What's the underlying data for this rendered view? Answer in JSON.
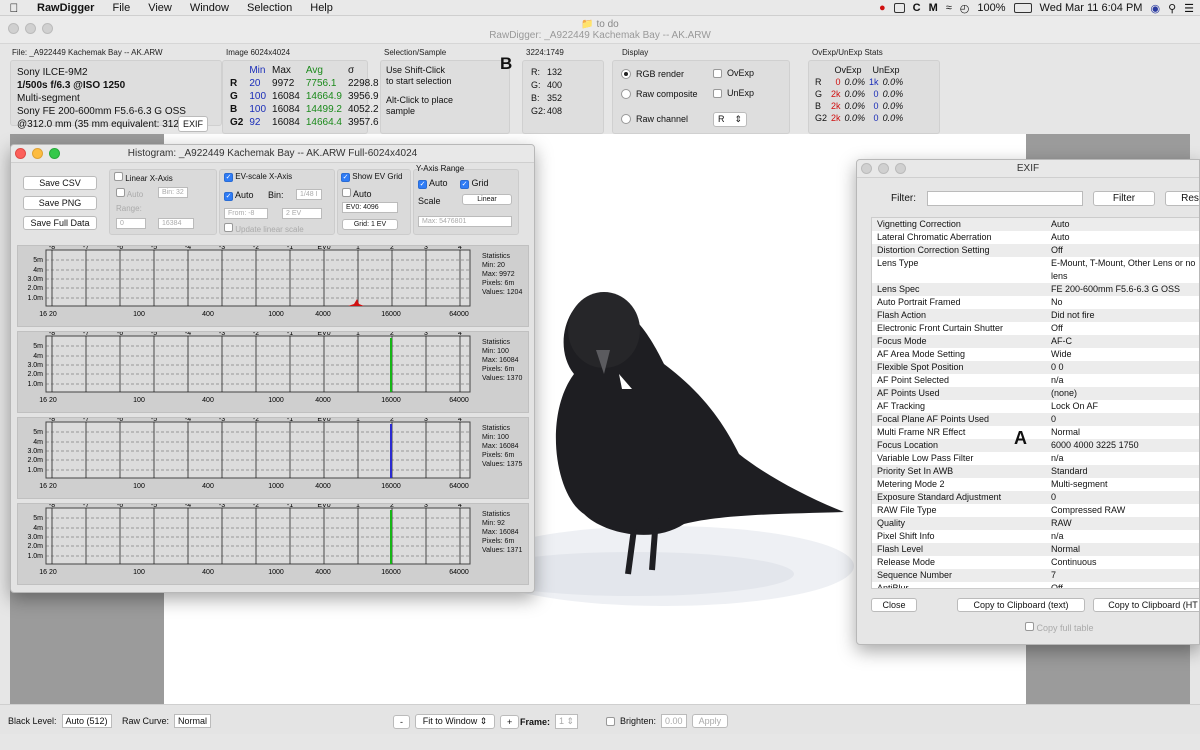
{
  "menubar": {
    "app": "RawDigger",
    "items": [
      "File",
      "View",
      "Window",
      "Selection",
      "Help"
    ],
    "battery": "100%",
    "clock": "Wed Mar 11  6:04 PM"
  },
  "window": {
    "folder": "to do",
    "title": "RawDigger: _A922449 Kachemak Bay -- AK.ARW"
  },
  "file_info": {
    "label": "File: _A922449 Kachemak Bay -- AK.ARW",
    "camera": "Sony ILCE-9M2",
    "exposure": "1/500s f/6.3 @ISO 1250",
    "metering": "Multi-segment",
    "lens": "Sony FE 200-600mm F5.6-6.3 G OSS",
    "focal": "@312.0 mm (35 mm equivalent: 312.0",
    "exif_button": "EXIF"
  },
  "image_stats": {
    "label": "Image 6024x4024",
    "headers": [
      "",
      "Min",
      "Max",
      "Avg",
      "σ"
    ],
    "rows": [
      {
        "ch": "R",
        "min": "20",
        "max": "9972",
        "avg": "7756.1",
        "sd": "2298.8"
      },
      {
        "ch": "G",
        "min": "100",
        "max": "16084",
        "avg": "14664.9",
        "sd": "3956.9"
      },
      {
        "ch": "B",
        "min": "100",
        "max": "16084",
        "avg": "14499.2",
        "sd": "4052.2"
      },
      {
        "ch": "G2",
        "min": "92",
        "max": "16084",
        "avg": "14664.4",
        "sd": "3957.6"
      }
    ]
  },
  "selection": {
    "label": "Selection/Sample",
    "line1": "Use Shift-Click",
    "line2": "to start selection",
    "line3": "Alt-Click to place",
    "line4": "sample"
  },
  "marker_b": "B",
  "marker_a": "A",
  "sample": {
    "label": "3224:1749",
    "r": "R:",
    "r_val": "132",
    "g": "G:",
    "g_val": "400",
    "b": "B:",
    "b_val": "352",
    "g2": "G2:",
    "g2_val": "408"
  },
  "display": {
    "label": "Display",
    "rgb_render": "RGB render",
    "raw_composite": "Raw composite",
    "raw_channel": "Raw channel",
    "ovexp": "OvExp",
    "unexp": "UnExp",
    "channel_value": "R"
  },
  "ovexp_stats": {
    "label": "OvExp/UnExp Stats",
    "h1": "OvExp",
    "h2": "UnExp",
    "rows": [
      {
        "ch": "R",
        "o": "0",
        "op": "0.0%",
        "u": "1k",
        "up": "0.0%"
      },
      {
        "ch": "G",
        "o": "2k",
        "op": "0.0%",
        "u": "0",
        "up": "0.0%"
      },
      {
        "ch": "B",
        "o": "2k",
        "op": "0.0%",
        "u": "0",
        "up": "0.0%"
      },
      {
        "ch": "G2",
        "o": "2k",
        "op": "0.0%",
        "u": "0",
        "up": "0.0%"
      }
    ]
  },
  "histogram": {
    "title": "Histogram: _A922449 Kachemak Bay -- AK.ARW Full-6024x4024",
    "save_csv": "Save CSV",
    "save_png": "Save PNG",
    "save_full": "Save Full Data",
    "linear_x": "Linear X-Axis",
    "auto": "Auto",
    "bin32": "Bin: 32",
    "range": "Range:",
    "range_from": "0",
    "range_to": "16384",
    "ev_scale": "EV-scale X-Axis",
    "auto2": "Auto",
    "bin": "Bin:",
    "bin_val": "1/48 I",
    "from": "From: -8",
    "to_val": "2 EV",
    "update_linear": "Update linear scale",
    "show_ev_grid": "Show EV Grid",
    "auto3": "Auto",
    "ev0": "EV0: 4096",
    "grid_ev": "Grid: 1 EV",
    "y_range": "Y-Axis Range",
    "auto4": "Auto",
    "grid": "Grid",
    "scale": "Scale",
    "scale_val": "Linear",
    "max_val": "Max: 5476801",
    "ev_ticks": [
      "-8",
      "-7",
      "-6",
      "-5",
      "-4",
      "-3",
      "-2",
      "-1",
      "EV0",
      "1",
      "2",
      "3",
      "4"
    ],
    "x_ticks": [
      "16 20",
      "100",
      "400",
      "1000",
      "4000",
      "16000",
      "64000"
    ],
    "y_ticks": [
      "5m",
      "4m",
      "3.0m",
      "2.0m",
      "1.0m"
    ],
    "graphs": [
      {
        "color": "#d01010",
        "stats_title": "Statistics",
        "min": "Min: 20",
        "max": "Max: 9972",
        "pixels": "Pixels: 6m",
        "values": "Values: 1204"
      },
      {
        "color": "#15b515",
        "stats_title": "Statistics",
        "min": "Min: 100",
        "max": "Max: 16084",
        "pixels": "Pixels: 6m",
        "values": "Values: 1370"
      },
      {
        "color": "#2a2ad0",
        "stats_title": "Statistics",
        "min": "Min: 100",
        "max": "Max: 16084",
        "pixels": "Pixels: 6m",
        "values": "Values: 1375"
      },
      {
        "color": "#15b515",
        "stats_title": "Statistics",
        "min": "Min: 92",
        "max": "Max: 16084",
        "pixels": "Pixels: 6m",
        "values": "Values: 1371"
      }
    ]
  },
  "exif": {
    "title": "EXIF",
    "filter_label": "Filter:",
    "filter_value": "",
    "filter_button": "Filter",
    "reset_button": "Res",
    "rows": [
      {
        "k": "Vignetting Correction",
        "v": "Auto"
      },
      {
        "k": "Lateral Chromatic Aberration",
        "v": "Auto"
      },
      {
        "k": "Distortion Correction Setting",
        "v": "Off"
      },
      {
        "k": "Lens Type",
        "v": "E-Mount, T-Mount, Other Lens or no lens"
      },
      {
        "k": "Lens Spec",
        "v": "FE 200-600mm F5.6-6.3 G OSS"
      },
      {
        "k": "Auto Portrait Framed",
        "v": "No"
      },
      {
        "k": "Flash Action",
        "v": "Did not fire"
      },
      {
        "k": "Electronic Front Curtain Shutter",
        "v": "Off"
      },
      {
        "k": "Focus Mode",
        "v": "AF-C"
      },
      {
        "k": "AF Area Mode Setting",
        "v": "Wide"
      },
      {
        "k": "Flexible Spot Position",
        "v": "0 0"
      },
      {
        "k": "AF Point Selected",
        "v": "n/a"
      },
      {
        "k": "AF Points Used",
        "v": "(none)"
      },
      {
        "k": "AF Tracking",
        "v": "Lock On AF"
      },
      {
        "k": "Focal Plane AF Points Used",
        "v": "0"
      },
      {
        "k": "Multi Frame NR Effect",
        "v": "Normal"
      },
      {
        "k": "Focus Location",
        "v": "6000 4000 3225 1750"
      },
      {
        "k": "Variable Low Pass Filter",
        "v": "n/a"
      },
      {
        "k": "Priority Set In AWB",
        "v": "Standard"
      },
      {
        "k": "Metering Mode 2",
        "v": "Multi-segment"
      },
      {
        "k": "Exposure Standard Adjustment",
        "v": "0"
      },
      {
        "k": "RAW File Type",
        "v": "Compressed RAW"
      },
      {
        "k": "Quality",
        "v": "RAW"
      },
      {
        "k": "Pixel Shift Info",
        "v": "n/a"
      },
      {
        "k": "Flash Level",
        "v": "Normal"
      },
      {
        "k": "Release Mode",
        "v": "Continuous"
      },
      {
        "k": "Sequence Number",
        "v": "7"
      },
      {
        "k": "AntiBlur",
        "v": "Off"
      }
    ],
    "close_button": "Close",
    "copy_text_button": "Copy to Clipboard (text)",
    "copy_html_button": "Copy to Clipboard (HT",
    "copy_full_table": "Copy full table"
  },
  "bottom": {
    "black_level_label": "Black Level:",
    "black_level_value": "Auto (512)",
    "raw_curve_label": "Raw Curve:",
    "raw_curve_value": "Normal",
    "zoom_minus": "-",
    "fit_to_window": "Fit to Window",
    "zoom_plus": "+",
    "frame_label": "Frame:",
    "frame_value": "1",
    "brighten_label": "Brighten:",
    "brighten_value": "0.00",
    "apply": "Apply"
  }
}
